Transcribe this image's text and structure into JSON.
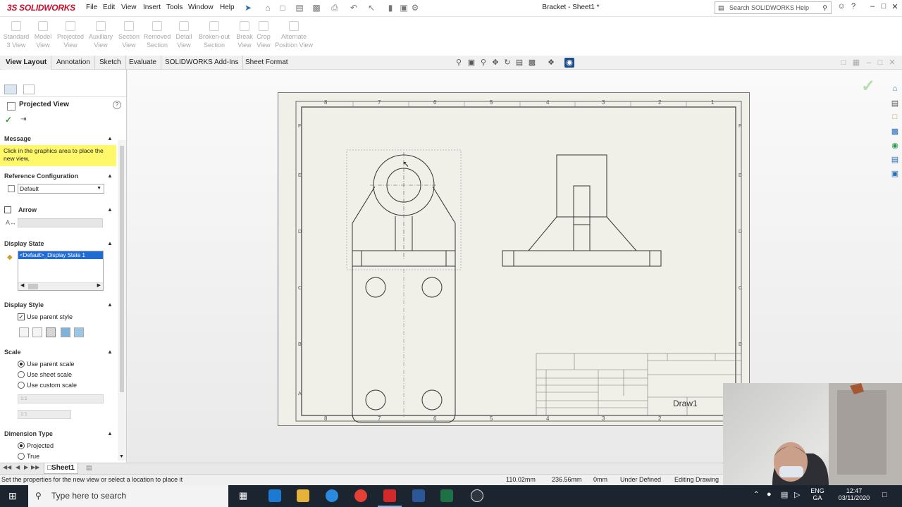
{
  "app": {
    "logo_text": "3S SOLIDWORKS",
    "menu": [
      "File",
      "Edit",
      "View",
      "Insert",
      "Tools",
      "Window",
      "Help"
    ],
    "document_title": "Bracket - Sheet1 *",
    "search_placeholder": "Search SOLIDWORKS Help"
  },
  "command_bar": {
    "items": [
      {
        "line1": "Standard",
        "line2": "3 View"
      },
      {
        "line1": "Model",
        "line2": "View"
      },
      {
        "line1": "Projected",
        "line2": "View"
      },
      {
        "line1": "Auxiliary",
        "line2": "View"
      },
      {
        "line1": "Section",
        "line2": "View"
      },
      {
        "line1": "Removed",
        "line2": "Section"
      },
      {
        "line1": "Detail",
        "line2": "View"
      },
      {
        "line1": "Broken-out",
        "line2": "Section"
      },
      {
        "line1": "Break",
        "line2": "View"
      },
      {
        "line1": "Crop",
        "line2": "View"
      },
      {
        "line1": "Alternate",
        "line2": "Position View"
      }
    ]
  },
  "tabs": [
    "View Layout",
    "Annotation",
    "Sketch",
    "Evaluate",
    "SOLIDWORKS Add-Ins",
    "Sheet Format"
  ],
  "panel": {
    "title": "Projected View",
    "message_header": "Message",
    "message_text": "Click in the graphics area to place the new view.",
    "ref_config_header": "Reference Configuration",
    "ref_config_value": "Default",
    "arrow_header": "Arrow",
    "display_state_header": "Display State",
    "display_state_value": "<Default>_Display State 1",
    "display_style_header": "Display Style",
    "use_parent_style": "Use parent style",
    "scale_header": "Scale",
    "scale_options": [
      "Use parent scale",
      "Use sheet scale",
      "Use custom scale"
    ],
    "scale_value_1": "1:1",
    "scale_value_2": "1:1",
    "dimension_type_header": "Dimension Type",
    "dimension_options": [
      "Projected",
      "True"
    ]
  },
  "sheet": {
    "col_labels_top": [
      "8",
      "7",
      "6",
      "5",
      "4",
      "3",
      "2",
      "1"
    ],
    "row_labels": [
      "F",
      "E",
      "D",
      "C",
      "B",
      "A"
    ],
    "title_block_text": "Draw1"
  },
  "sheet_tabs": {
    "active": "Sheet1"
  },
  "status": {
    "message": "Set the properties for the new view or select a location to place it",
    "x": "110.02mm",
    "y": "236.56mm",
    "z": "0mm",
    "state": "Under Defined",
    "mode": "Editing Drawing"
  },
  "taskbar": {
    "search_placeholder": "Type here to search",
    "lang_line1": "ENG",
    "lang_line2": "GA",
    "time": "12:47",
    "date": "03/11/2020"
  }
}
